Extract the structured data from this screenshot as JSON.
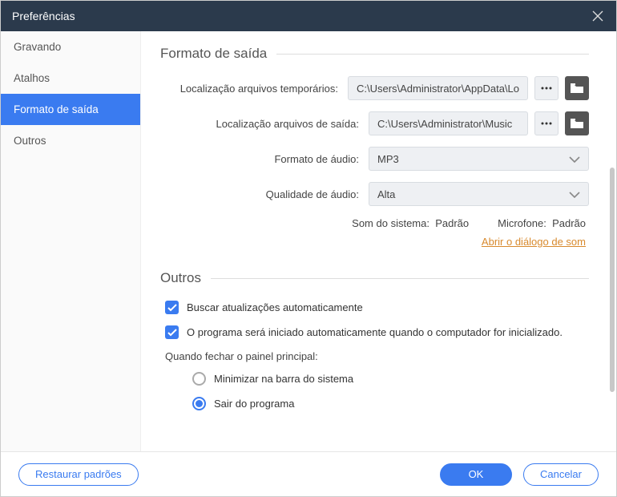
{
  "titlebar": {
    "title": "Preferências"
  },
  "sidebar": {
    "items": [
      {
        "label": "Gravando"
      },
      {
        "label": "Atalhos"
      },
      {
        "label": "Formato de saída"
      },
      {
        "label": "Outros"
      }
    ],
    "activeIndex": 2
  },
  "sections": {
    "output": {
      "heading": "Formato de saída",
      "tempLocLabel": "Localização arquivos temporários:",
      "tempLocValue": "C:\\Users\\Administrator\\AppData\\Lo",
      "outLocLabel": "Localização arquivos de saída:",
      "outLocValue": "C:\\Users\\Administrator\\Music",
      "audioFormatLabel": "Formato de áudio:",
      "audioFormatValue": "MP3",
      "audioQualityLabel": "Qualidade de áudio:",
      "audioQualityValue": "Alta",
      "sysSoundLabel": "Som do sistema:",
      "sysSoundValue": "Padrão",
      "micLabel": "Microfone:",
      "micValue": "Padrão",
      "openSoundLink": "Abrir o diálogo de som"
    },
    "others": {
      "heading": "Outros",
      "checkUpdates": "Buscar atualizações automaticamente",
      "autostart": "O programa será iniciado automaticamente quando o computador for inicializado.",
      "closeGroup": "Quando fechar o painel principal:",
      "minimize": "Minimizar na barra do sistema",
      "exit": "Sair do programa"
    }
  },
  "footer": {
    "restore": "Restaurar padrões",
    "ok": "OK",
    "cancel": "Cancelar"
  }
}
